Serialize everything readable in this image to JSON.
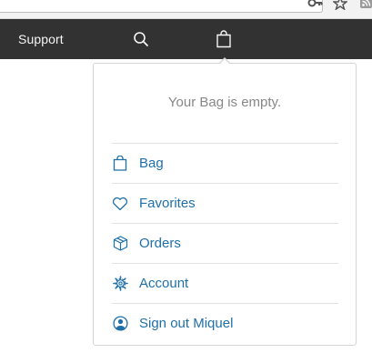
{
  "nav": {
    "support_label": "Support",
    "search_icon": "search-icon",
    "bag_icon": "bag-icon"
  },
  "bag_flyout": {
    "empty_message": "Your Bag is empty.",
    "items": [
      {
        "label": "Bag",
        "icon": "bag-icon"
      },
      {
        "label": "Favorites",
        "icon": "heart-icon"
      },
      {
        "label": "Orders",
        "icon": "box-icon"
      },
      {
        "label": "Account",
        "icon": "gear-icon"
      },
      {
        "label": "Sign out Miquel",
        "icon": "user-icon"
      }
    ]
  },
  "colors": {
    "nav_background": "#323232",
    "link": "#1f6fa8",
    "muted_text": "#888888"
  }
}
